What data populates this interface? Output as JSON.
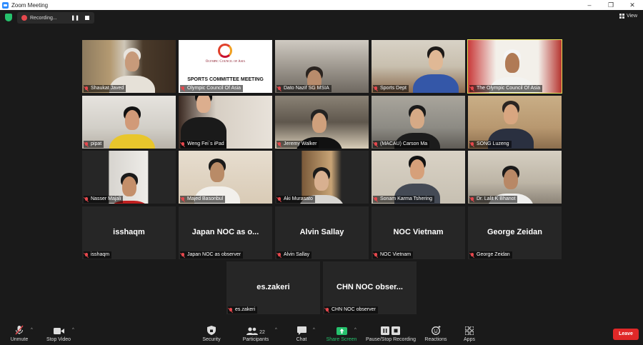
{
  "window": {
    "title": "Zoom Meeting",
    "controls": [
      "–",
      "❐",
      "✕"
    ]
  },
  "recording": {
    "label": "Recording...",
    "pause": "❚❚"
  },
  "view": {
    "label": "View"
  },
  "participants": [
    {
      "name": "Shaukat Javed",
      "kind": "video"
    },
    {
      "name": "Olympic Council Of Asia",
      "kind": "slide",
      "slide_title": "SPORTS COMMITTEE MEETING",
      "slide_logo": "Olympic Council of Asia"
    },
    {
      "name": "Dato Nazif SG MSIA",
      "kind": "video"
    },
    {
      "name": "Sports Dept",
      "kind": "video"
    },
    {
      "name": "The Olympic Council Of Asia",
      "kind": "video",
      "active": true
    },
    {
      "name": "pipat",
      "kind": "video"
    },
    {
      "name": "Weng Fei`s iPad",
      "kind": "video"
    },
    {
      "name": "Jeremy Walker",
      "kind": "video"
    },
    {
      "name": "(MACAU) Carson Ma",
      "kind": "video"
    },
    {
      "name": "SONG Luzeng",
      "kind": "video"
    },
    {
      "name": "Nasser Majali",
      "kind": "video"
    },
    {
      "name": "Majed Basonbul",
      "kind": "video"
    },
    {
      "name": "Aki Murasato",
      "kind": "video"
    },
    {
      "name": "Sonam Karma Tshering",
      "kind": "video"
    },
    {
      "name": "Dr. Lalit K Bhanot",
      "kind": "video"
    },
    {
      "name": "isshaqm",
      "kind": "name",
      "display": "isshaqm"
    },
    {
      "name": "Japan NOC as observer",
      "kind": "name",
      "display": "Japan NOC as o..."
    },
    {
      "name": "Alvin Sallay",
      "kind": "name",
      "display": "Alvin Sallay"
    },
    {
      "name": "NOC Vietnam",
      "kind": "name",
      "display": "NOC Vietnam"
    },
    {
      "name": "George Zeidan",
      "kind": "name",
      "display": "George Zeidan"
    },
    {
      "name": "es.zakeri",
      "kind": "name",
      "display": "es.zakeri"
    },
    {
      "name": "CHN NOC observer",
      "kind": "name",
      "display": "CHN NOC obser..."
    }
  ],
  "toolbar": {
    "unmute": "Unmute",
    "stop_video": "Stop Video",
    "security": "Security",
    "participants": "Participants",
    "participants_count": "22",
    "chat": "Chat",
    "share_screen": "Share Screen",
    "pause_stop_recording": "Pause/Stop Recording",
    "reactions": "Reactions",
    "apps": "Apps",
    "leave": "Leave"
  },
  "colors": {
    "accent": "#2D8CFF",
    "active_speaker": "#e8e35a",
    "share": "#26c26d",
    "leave": "#e02828",
    "muted": "#e5484d"
  }
}
